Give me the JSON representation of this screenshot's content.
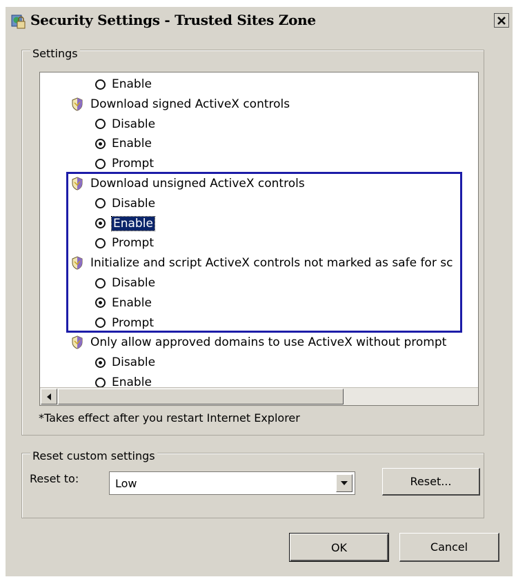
{
  "window": {
    "title": "Security Settings - Trusted Sites Zone",
    "close_glyph": "✕"
  },
  "settings": {
    "group_label": "Settings",
    "items": [
      {
        "type": "option",
        "label": "Enable",
        "checked": false
      },
      {
        "type": "setting",
        "label": "Download signed ActiveX controls",
        "icon": "shield-icon"
      },
      {
        "type": "option",
        "label": "Disable",
        "checked": false
      },
      {
        "type": "option",
        "label": "Enable",
        "checked": true
      },
      {
        "type": "option",
        "label": "Prompt",
        "checked": false
      },
      {
        "type": "setting",
        "label": "Download unsigned ActiveX controls",
        "icon": "shield-icon"
      },
      {
        "type": "option",
        "label": "Disable",
        "checked": false
      },
      {
        "type": "option",
        "label": "Enable",
        "checked": true,
        "selected": true
      },
      {
        "type": "option",
        "label": "Prompt",
        "checked": false
      },
      {
        "type": "setting",
        "label": "Initialize and script ActiveX controls not marked as safe for sc",
        "icon": "shield-icon"
      },
      {
        "type": "option",
        "label": "Disable",
        "checked": false
      },
      {
        "type": "option",
        "label": "Enable",
        "checked": true
      },
      {
        "type": "option",
        "label": "Prompt",
        "checked": false
      },
      {
        "type": "setting",
        "label": "Only allow approved domains to use ActiveX without prompt",
        "icon": "shield-icon"
      },
      {
        "type": "option",
        "label": "Disable",
        "checked": true
      },
      {
        "type": "option",
        "label": "Enable",
        "checked": false
      }
    ],
    "note": "*Takes effect after you restart Internet Explorer"
  },
  "reset": {
    "group_label": "Reset custom settings",
    "reset_to_label": "Reset to:",
    "selected_value": "Low",
    "reset_button": "Reset..."
  },
  "buttons": {
    "ok": "OK",
    "cancel": "Cancel"
  },
  "colors": {
    "selection": "#0a246a",
    "highlight_box": "#1c1ca8",
    "window_bg": "#d8d5cc"
  }
}
